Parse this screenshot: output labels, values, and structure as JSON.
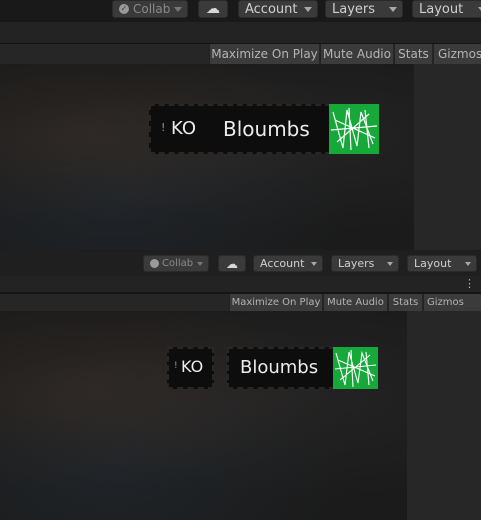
{
  "toolbar": {
    "collab_label": "Collab",
    "account_label": "Account",
    "layers_label": "Layers",
    "layout_label": "Layout"
  },
  "game_bar": {
    "maximize_label": "Maximize On Play",
    "mute_label": "Mute Audio",
    "stats_label": "Stats",
    "gizmos_label": "Gizmos"
  },
  "hud": {
    "indicator_glyph": "!",
    "status_text": "KO",
    "player_name": "Bloumbs"
  },
  "colors": {
    "tag_green": "#17a83a",
    "hud_bg": "#0d0d0d"
  }
}
